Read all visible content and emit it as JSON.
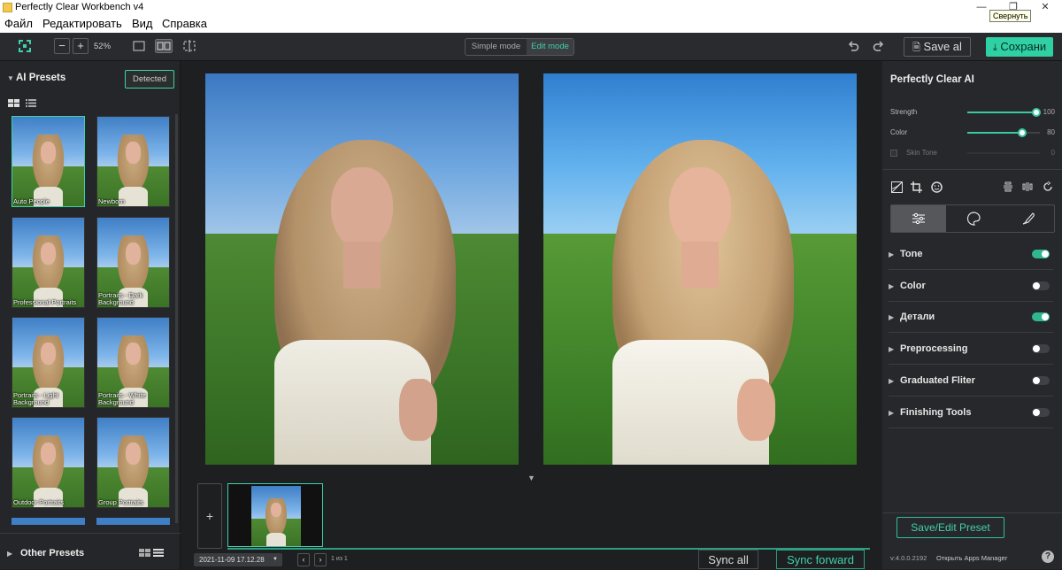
{
  "window": {
    "title": "Perfectly Clear Workbench v4",
    "tooltip": "Свернуть"
  },
  "menu": {
    "items": [
      "Файл",
      "Редактировать",
      "Вид",
      "Справка"
    ]
  },
  "toolbar": {
    "zoom": "52%",
    "simple_mode": "Simple mode",
    "edit_mode": "Edit mode",
    "save_all": "Save al",
    "save": "Сохрани"
  },
  "left": {
    "title": "AI Presets",
    "detected": "Detected",
    "presets": [
      "Auto People",
      "Newborn",
      "Professional Portraits",
      "Portraits - Dark Background",
      "Portraits - Light Background",
      "Portraits - White Background",
      "Outdoor Portraits",
      "Group Portraits"
    ],
    "other_presets": "Other Presets"
  },
  "right": {
    "title": "Perfectly Clear AI",
    "sliders": [
      {
        "label": "Strength",
        "value": "100",
        "fraction": 0.95
      },
      {
        "label": "Color",
        "value": "80",
        "fraction": 0.76
      },
      {
        "label": "Skin Tone",
        "value": "0",
        "fraction": 0
      }
    ],
    "sections": [
      {
        "name": "Tone",
        "on": true
      },
      {
        "name": "Color",
        "on": false
      },
      {
        "name": "Детали",
        "on": true
      },
      {
        "name": "Preprocessing",
        "on": false
      },
      {
        "name": "Graduated Fliter",
        "on": false
      },
      {
        "name": "Finishing Tools",
        "on": false
      }
    ],
    "save_preset": "Save/Edit Preset",
    "version": "v:4.0.0.2192",
    "apps_manager": "Открыть Apps Manager"
  },
  "bottom": {
    "timestamp": "2021-11-09 17.12.28",
    "page": "1 из 1",
    "sync_all": "Sync all",
    "sync_forward": "Sync forward"
  },
  "colors": {
    "accent": "#2fd0a4",
    "panel": "#27282b",
    "background": "#1e1f21"
  }
}
